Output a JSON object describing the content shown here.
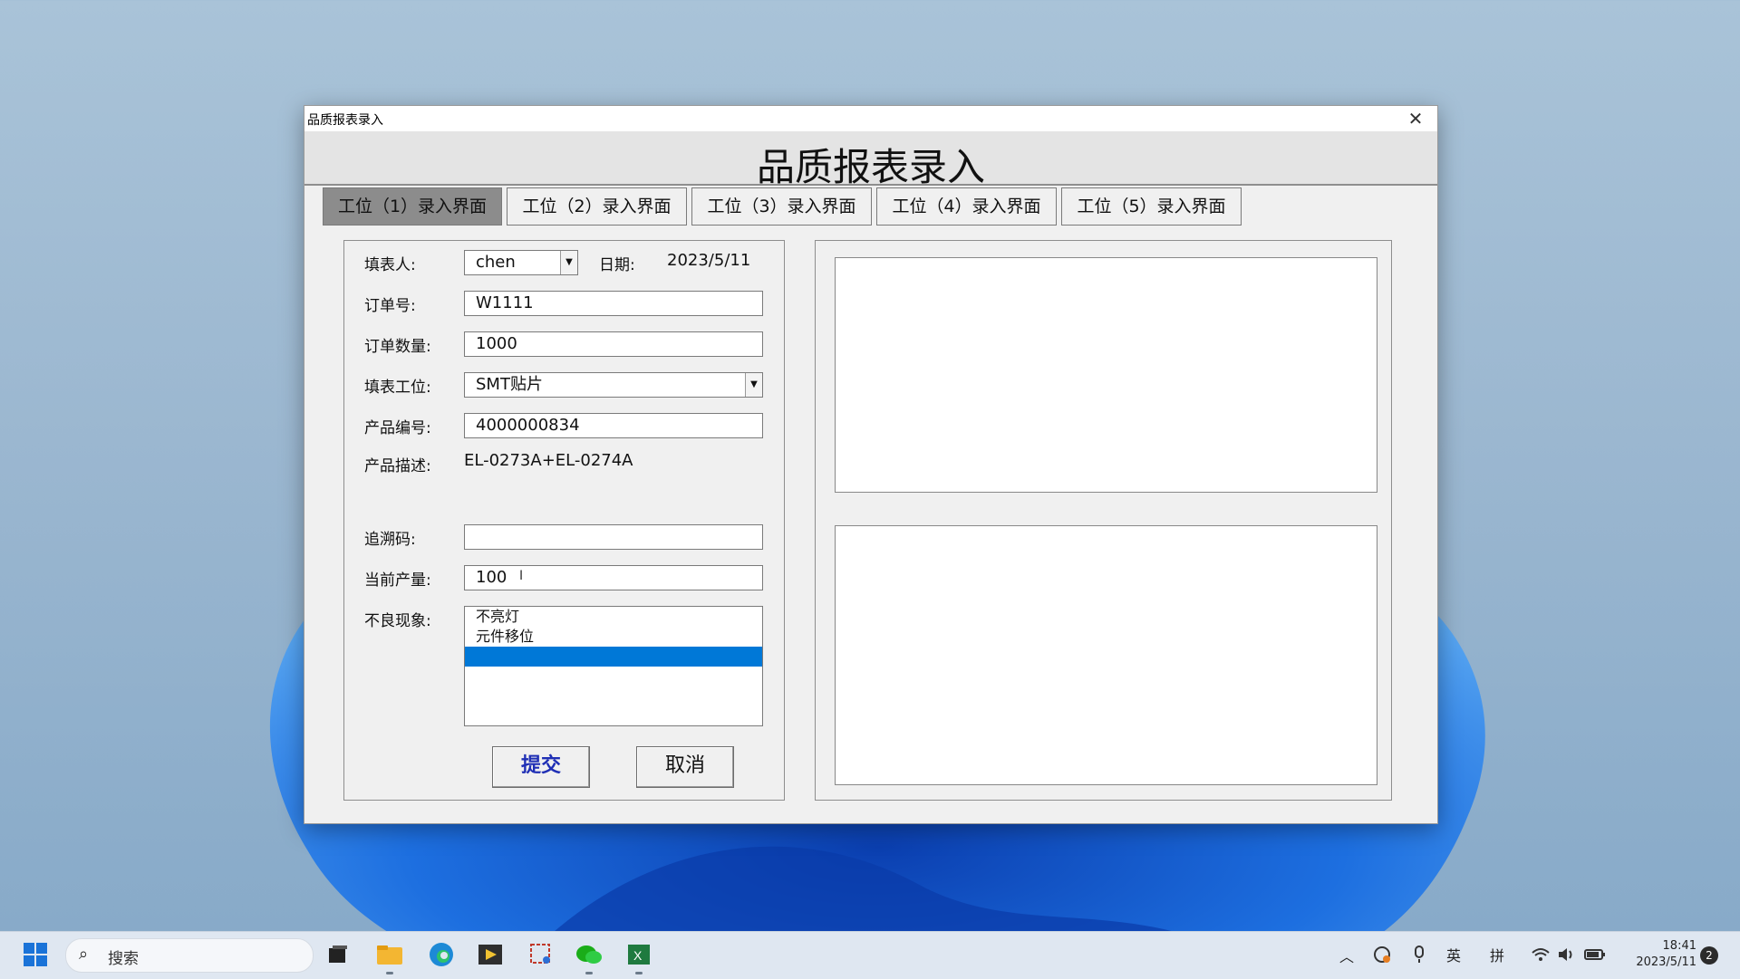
{
  "window": {
    "title": "品质报表录入",
    "heading": "品质报表录入",
    "close_glyph": "✕"
  },
  "tabs": [
    {
      "label": "工位（1）录入界面",
      "active": true
    },
    {
      "label": "工位（2）录入界面",
      "active": false
    },
    {
      "label": "工位（3）录入界面",
      "active": false
    },
    {
      "label": "工位（4）录入界面",
      "active": false
    },
    {
      "label": "工位（5）录入界面",
      "active": false
    }
  ],
  "form": {
    "filler_label": "填表人:",
    "filler_value": "chen",
    "date_label": "日期:",
    "date_value": "2023/5/11",
    "order_no_label": "订单号:",
    "order_no_value": "W1111",
    "order_qty_label": "订单数量:",
    "order_qty_value": "1000",
    "station_label": "填表工位:",
    "station_value": "SMT贴片",
    "product_no_label": "产品编号:",
    "product_no_value": "4000000834",
    "product_desc_label": "产品描述:",
    "product_desc_value": "EL-0273A+EL-0274A",
    "trace_label": "追溯码:",
    "trace_value": "",
    "current_qty_label": "当前产量:",
    "current_qty_value": "100",
    "defect_label": "不良现象:",
    "defect_options": [
      "不亮灯",
      "元件移位",
      ""
    ],
    "selected_defect_index": 2,
    "submit_label": "提交",
    "cancel_label": "取消"
  },
  "taskbar": {
    "search_placeholder": "搜索",
    "ime_lang": "英",
    "ime_mode": "拼",
    "time": "18:41",
    "date": "2023/5/11",
    "notification_count": "2",
    "icons": [
      "windows-start-icon",
      "search-icon",
      "task-view-icon",
      "file-explorer-icon",
      "edge-browser-icon",
      "media-app-icon",
      "snipping-tool-icon",
      "wechat-icon",
      "excel-icon",
      "tray-chevron-icon",
      "sync-icon",
      "microphone-icon",
      "wifi-icon",
      "volume-icon",
      "battery-icon"
    ]
  },
  "colors": {
    "selection": "#0078d7",
    "primary_button_text": "#1f2fb5",
    "active_tab": "#8c8c8c",
    "windows_blue": "#1a73d8"
  }
}
